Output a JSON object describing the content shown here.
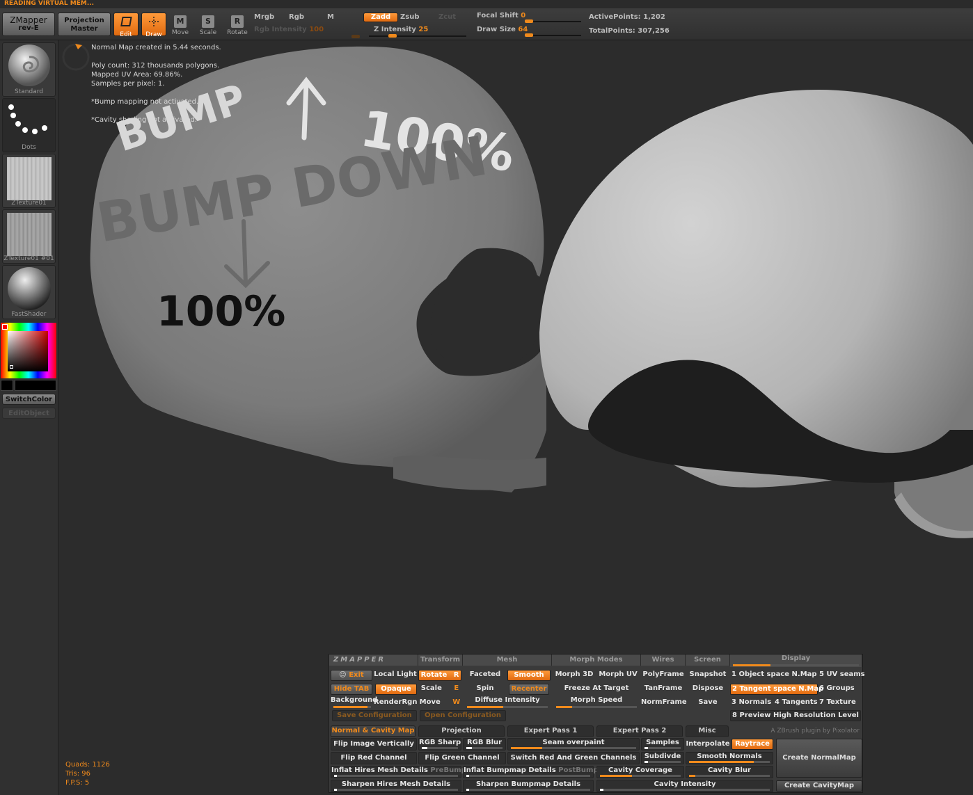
{
  "status_message": "READING VIRTUAL MEM...",
  "toolbar": {
    "zmapper_label": "ZMapper",
    "zmapper_sub": "rev-E",
    "projection_label": "Projection",
    "projection_sub": "Master",
    "edit": "Edit",
    "draw": "Draw",
    "move": "Move",
    "scale": "Scale",
    "rotate": "Rotate",
    "move_key": "M",
    "scale_key": "S",
    "rotate_key": "R",
    "mrgb": "Mrgb",
    "rgb": "Rgb",
    "m": "M",
    "rgb_intensity_label": "Rgb Intensity",
    "rgb_intensity_value": "100",
    "zadd": "Zadd",
    "zsub": "Zsub",
    "zcut": "Zcut",
    "z_intensity_label": "Z Intensity",
    "z_intensity_value": "25",
    "focal_shift_label": "Focal Shift",
    "focal_shift_value": "0",
    "draw_size_label": "Draw Size",
    "draw_size_value": "64",
    "active_points_label": "ActivePoints:",
    "active_points_value": "1,202",
    "total_points_label": "TotalPoints:",
    "total_points_value": "307,256"
  },
  "shelf": {
    "tiles": [
      "Standard",
      "Dots",
      "ZTexture01",
      "ZTexture01 #01",
      "FastShader"
    ],
    "switch_color": "SwitchColor",
    "edit_object": "EditObject",
    "colors": {
      "accent": "#f08a1c",
      "fill_black": "#000000"
    }
  },
  "viewport": {
    "info_lines": [
      "Normal Map created in 5.44 seconds.",
      "",
      "Poly count: 312 thousands polygons.",
      "Mapped UV Area: 69.86%.",
      "Samples per pixel: 1.",
      "",
      "*Bump mapping not activated.",
      "",
      "*Cavity shading not activated."
    ],
    "annotations": {
      "bump_up": "BUMP",
      "bump_up_pct": "100%",
      "bump_down": "BUMP DOWN",
      "bump_down_pct": "100%"
    },
    "stats": {
      "quads": "Quads: 1126",
      "tris": "Tris: 96",
      "fps": "F.P.S: 5"
    }
  },
  "zmapper": {
    "logo": "ZMAPPER",
    "headers": [
      "Transform",
      "Mesh",
      "Morph Modes",
      "Wires",
      "Screen",
      "Display"
    ],
    "exit": "Exit",
    "local_light": "Local Light",
    "rotate": "Rotate",
    "rotate_key": "R",
    "faceted": "Faceted",
    "smooth": "Smooth",
    "morph_3d": "Morph 3D",
    "morph_uv": "Morph UV",
    "polyframe": "PolyFrame",
    "snapshot": "Snapshot",
    "object_space": "1 Object space N.Map",
    "uv_seams": "5 UV seams",
    "hide_tab": "Hide TAB",
    "opaque": "Opaque",
    "scale": "Scale",
    "scale_key": "E",
    "spin": "Spin",
    "recenter": "Recenter",
    "freeze": "Freeze At Target",
    "tanframe": "TanFrame",
    "dispose": "Dispose",
    "tangent_space": "2 Tangent space N.Map",
    "groups": "6 Groups",
    "background": "Background",
    "render_rgn": "RenderRgn",
    "move": "Move",
    "move_key": "W",
    "diffuse_intensity": "Diffuse Intensity",
    "morph_speed": "Morph Speed",
    "normframe": "NormFrame",
    "save": "Save",
    "normals": "3 Normals",
    "tangents": "4 Tangents",
    "texture": "7 Texture",
    "save_config": "Save Configuration",
    "open_config": "Open Configuration",
    "preview_high": "8 Preview High Resolution Level",
    "tabs": [
      "Normal & Cavity Map",
      "Projection",
      "Expert Pass 1",
      "Expert Pass 2",
      "Misc"
    ],
    "credit": "A ZBrush plugin by Pixolator",
    "flip_vertical": "Flip Image Vertically",
    "rgb_sharp": "RGB Sharp",
    "rgb_blur": "RGB Blur",
    "seam_overpaint": "Seam overpaint",
    "samples": "Samples",
    "interpolate": "Interpolate",
    "raytrace": "Raytrace",
    "create_normal_map": "Create NormalMap",
    "flip_red": "Flip Red Channel",
    "flip_green": "Flip Green Channel",
    "switch_rg": "Switch Red And Green Channels",
    "subdivide": "Subdivde",
    "smooth_normals": "Smooth Normals",
    "inflat_hires": "Inflat Hires Mesh Details",
    "prebump": "PreBump",
    "inflat_bump": "Inflat Bumpmap Details",
    "postbump": "PostBump",
    "cavity_coverage": "Cavity Coverage",
    "cavity_blur": "Cavity Blur",
    "sharpen_hires": "Sharpen Hires Mesh Details",
    "sharpen_bump": "Sharpen Bumpmap Details",
    "cavity_intensity": "Cavity Intensity",
    "create_cavity_map": "Create CavityMap"
  }
}
